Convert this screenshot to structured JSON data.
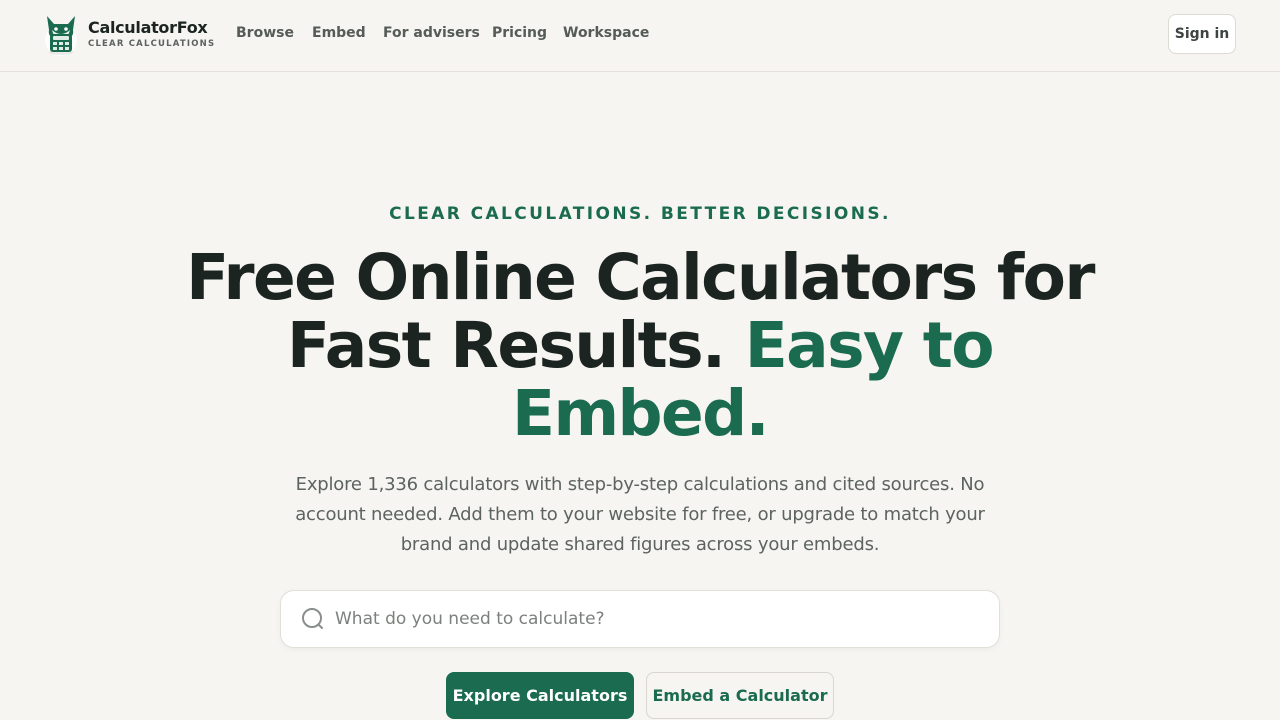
{
  "brand": {
    "name": "CalculatorFox",
    "tagline": "CLEAR CALCULATIONS",
    "logo_icon": "fox-calculator-logo"
  },
  "nav": {
    "items": [
      {
        "label": "Browse"
      },
      {
        "label": "Embed"
      },
      {
        "label": "For advisers"
      },
      {
        "label": "Pricing"
      },
      {
        "label": "Workspace"
      }
    ],
    "signin_label": "Sign in"
  },
  "hero": {
    "eyebrow": "CLEAR CALCULATIONS. BETTER DECISIONS.",
    "headline_line1": "Free Online Calculators for",
    "headline_line2_plain": "Fast Results.",
    "headline_line2_accent": "Easy to",
    "headline_line3_accent": "Embed.",
    "subtitle": "Explore 1,336 calculators with step-by-step calculations and cited sources. No account needed. Add them to your website for free, or upgrade to match your brand and update shared figures across your embeds."
  },
  "search": {
    "placeholder": "What do you need to calculate?",
    "value": "",
    "icon": "search-icon"
  },
  "cta": {
    "primary_label": "Explore Calculators",
    "secondary_label": "Embed a Calculator"
  },
  "colors": {
    "accent": "#1a6b4f",
    "background": "#f6f5f1",
    "text": "#1b2420",
    "muted": "#5d6360"
  }
}
